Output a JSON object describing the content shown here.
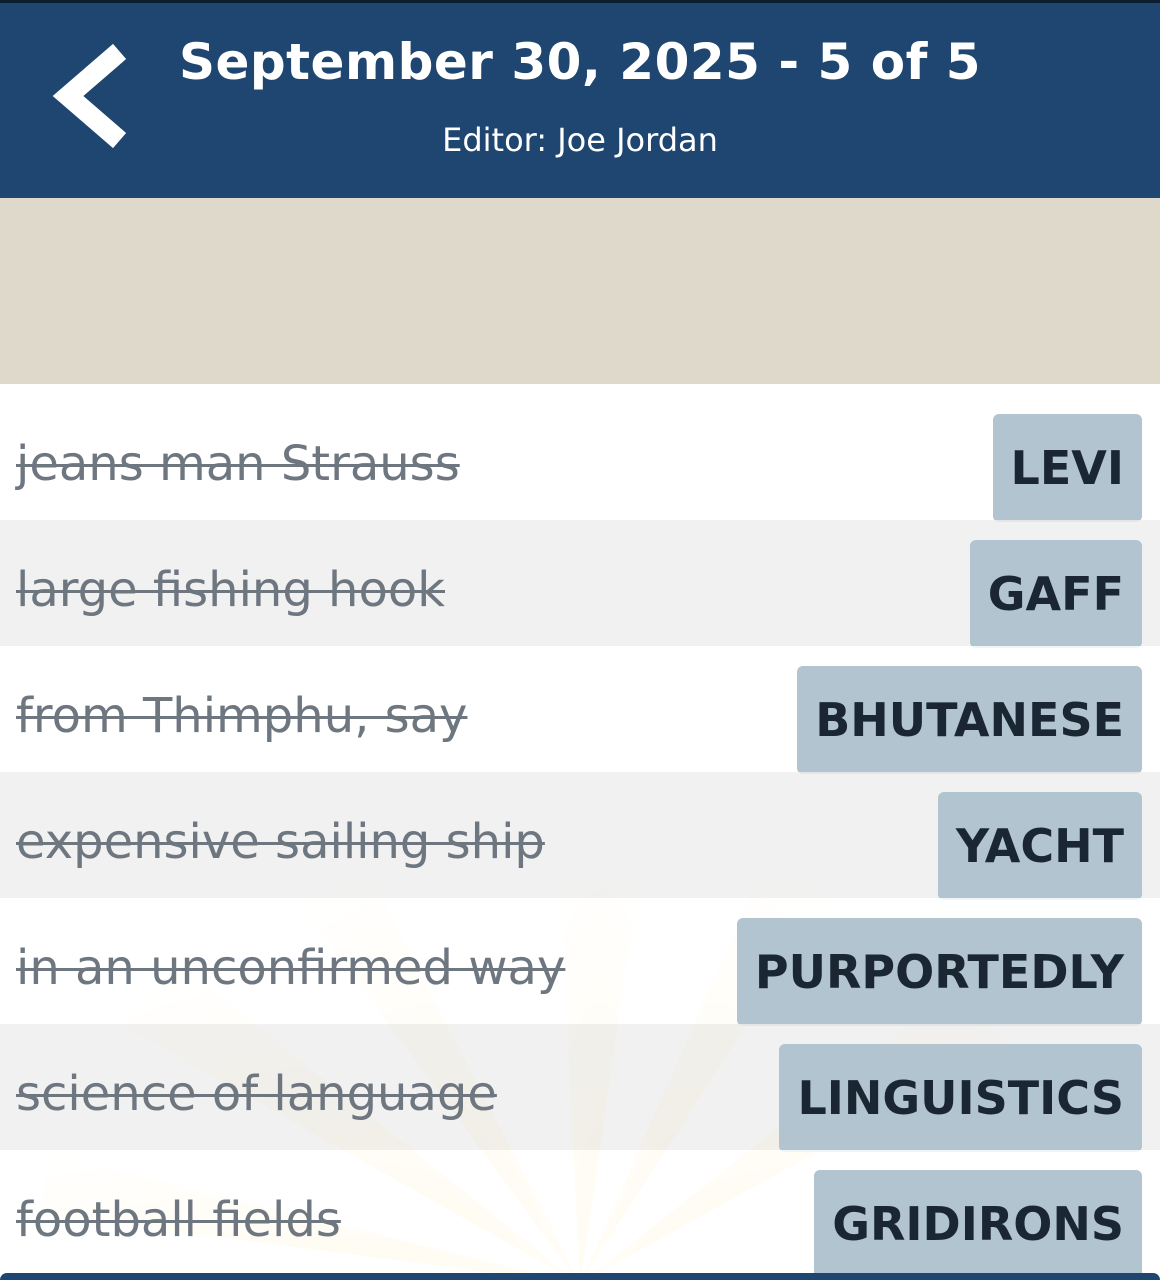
{
  "header": {
    "title": "September 30, 2025 - 5 of 5",
    "editor": "Editor: Joe Jordan",
    "back_icon": "chevron-left-icon"
  },
  "colors": {
    "header_bg": "#1f4670",
    "banner_bg": "#dfd9cc",
    "answer_bg": "#b2c4d0",
    "row_alt_bg": "#eeeeee",
    "clue_text": "#6e7680",
    "answer_text": "#1a2733"
  },
  "clues": [
    {
      "clue": "jeans man Strauss",
      "answer": "LEVI",
      "solved": true
    },
    {
      "clue": "large fishing hook",
      "answer": "GAFF",
      "solved": true
    },
    {
      "clue": "from Thimphu, say",
      "answer": "BHUTANESE",
      "solved": true
    },
    {
      "clue": "expensive sailing ship",
      "answer": "YACHT",
      "solved": true
    },
    {
      "clue": "in an unconfirmed way",
      "answer": "PURPORTEDLY",
      "solved": true
    },
    {
      "clue": "science of language",
      "answer": "LINGUISTICS",
      "solved": true
    },
    {
      "clue": "football fields",
      "answer": "GRIDIRONS",
      "solved": true
    }
  ]
}
